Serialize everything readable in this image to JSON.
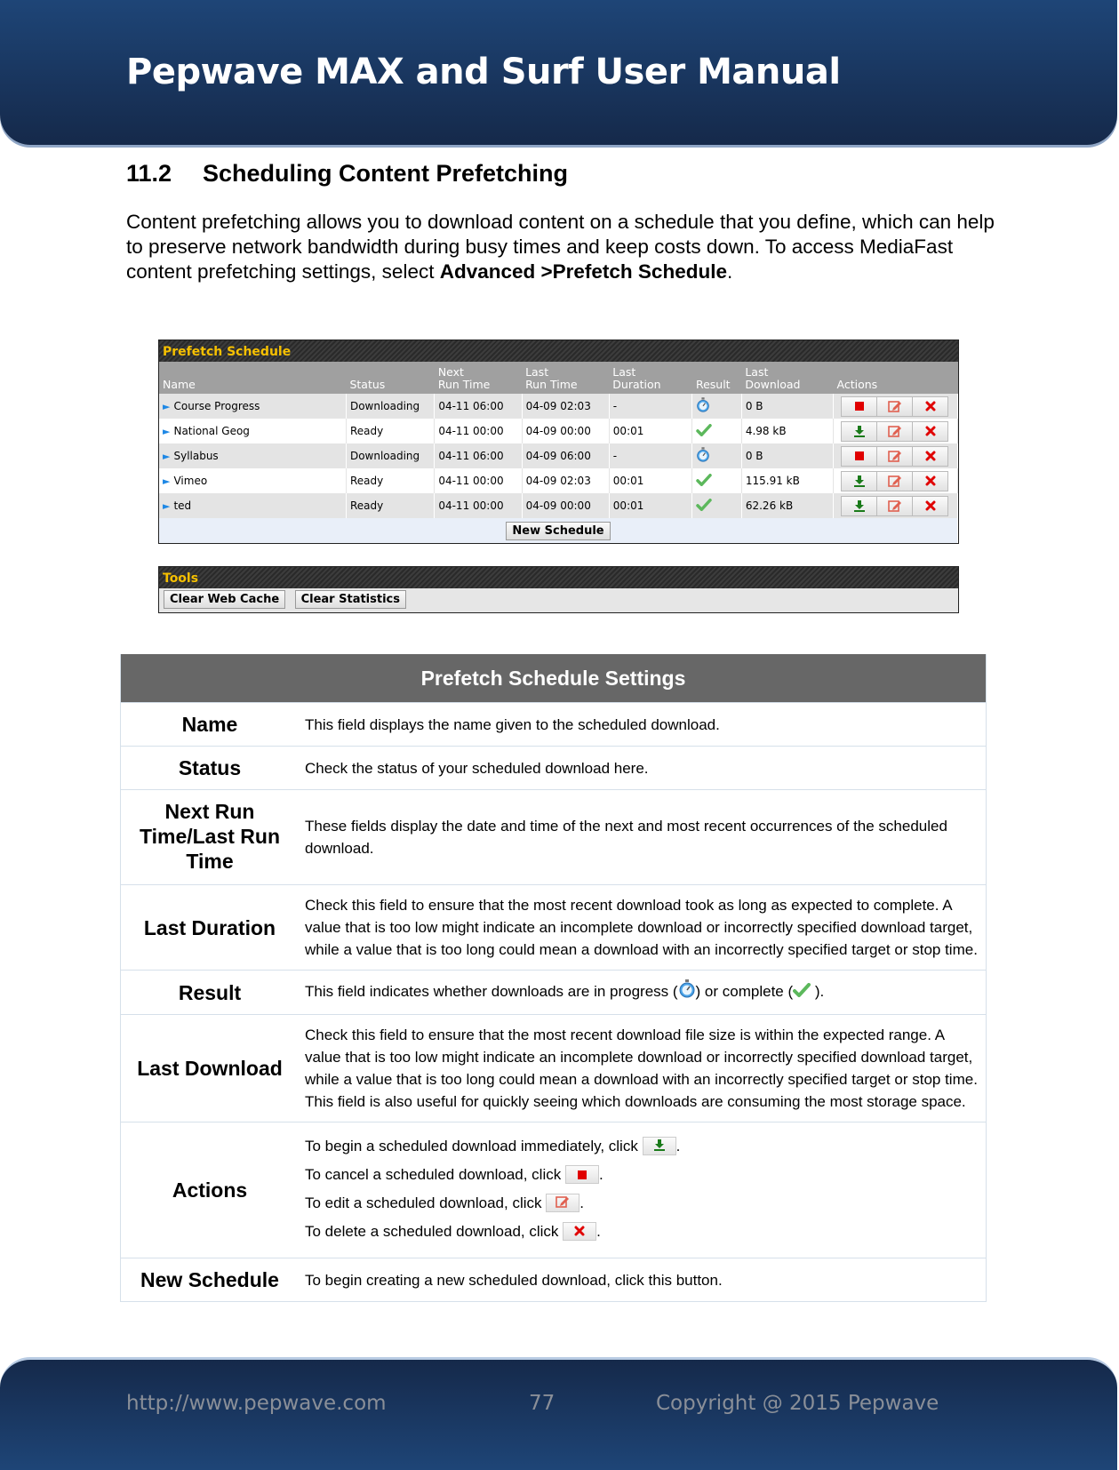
{
  "header": {
    "title": "Pepwave MAX and Surf User Manual"
  },
  "section": {
    "number": "11.2",
    "title": "Scheduling Content Prefetching",
    "intro_plain": "Content prefetching allows you to download content on a schedule that you define, which can help to preserve network bandwidth during busy times and keep costs down. To access MediaFast content prefetching settings, select ",
    "intro_bold": "Advanced >Prefetch Schedule",
    "intro_end": "."
  },
  "prefetch_panel": {
    "title": "Prefetch Schedule",
    "columns": [
      "Name",
      "Status",
      "Next Run Time",
      "Last Run Time",
      "Last Duration",
      "Result",
      "Last Download",
      "Actions"
    ],
    "column_lines": [
      [
        "",
        "Name"
      ],
      [
        "",
        "Status"
      ],
      [
        "Next",
        "Run Time"
      ],
      [
        "Last",
        "Run Time"
      ],
      [
        "Last",
        "Duration"
      ],
      [
        "",
        "Result"
      ],
      [
        "Last",
        "Download"
      ],
      [
        "",
        "Actions"
      ]
    ],
    "rows": [
      {
        "name": "Course Progress",
        "status": "Downloading",
        "next_run": "04-11 06:00",
        "last_run": "04-09 02:03",
        "duration": "-",
        "result": "in-progress",
        "last_download": "0 B",
        "primary_action": "stop"
      },
      {
        "name": "National Geog",
        "status": "Ready",
        "next_run": "04-11 00:00",
        "last_run": "04-09 00:00",
        "duration": "00:01",
        "result": "complete",
        "last_download": "4.98 kB",
        "primary_action": "download"
      },
      {
        "name": "Syllabus",
        "status": "Downloading",
        "next_run": "04-11 06:00",
        "last_run": "04-09 06:00",
        "duration": "-",
        "result": "in-progress",
        "last_download": "0 B",
        "primary_action": "stop"
      },
      {
        "name": "Vimeo",
        "status": "Ready",
        "next_run": "04-11 00:00",
        "last_run": "04-09 02:03",
        "duration": "00:01",
        "result": "complete",
        "last_download": "115.91 kB",
        "primary_action": "download"
      },
      {
        "name": "ted",
        "status": "Ready",
        "next_run": "04-11 00:00",
        "last_run": "04-09 00:00",
        "duration": "00:01",
        "result": "complete",
        "last_download": "62.26 kB",
        "primary_action": "download"
      }
    ],
    "new_schedule_label": "New Schedule"
  },
  "tools_panel": {
    "title": "Tools",
    "clear_web_cache_label": "Clear Web Cache",
    "clear_statistics_label": "Clear Statistics"
  },
  "settings_table": {
    "title": "Prefetch Schedule Settings",
    "rows": [
      {
        "key": "Name",
        "value": "This field displays the name given to the scheduled download."
      },
      {
        "key": "Status",
        "value": "Check the status of your scheduled download here."
      },
      {
        "key": "Next Run Time/Last Run Time",
        "value": "These fields display the date and time of the next and most recent occurrences of the scheduled download."
      },
      {
        "key": "Last Duration",
        "value": "Check this field to ensure that the most recent download took as long as expected to complete. A value that is too low might indicate an incomplete download or incorrectly specified download target, while a value that is too long could mean a download with an incorrectly specified target or stop time."
      },
      {
        "key": "Result",
        "value_before": "This field indicates whether downloads are in progress (",
        "value_mid": ") or complete (",
        "value_after": " )."
      },
      {
        "key": "Last Download",
        "value": "Check this field to ensure that the most recent download file size is within the expected range. A value that is too low might indicate an incomplete download or incorrectly specified download target, while a value that is too long could mean a download with an incorrectly specified target or stop time. This field is also useful for quickly seeing which downloads are consuming the most storage space."
      },
      {
        "key": "Actions",
        "lines": [
          "To begin a scheduled download immediately, click ",
          "To cancel a scheduled download, click ",
          "To edit a scheduled download, click ",
          "To delete a scheduled download, click "
        ]
      },
      {
        "key": "New Schedule",
        "value": "To begin creating a new scheduled download, click this button."
      }
    ]
  },
  "footer": {
    "url": "http://www.pepwave.com",
    "page": "77",
    "copyright": "Copyright @ 2015 Pepwave"
  },
  "colors": {
    "header_blue": "#1e4577",
    "panel_title_yellow": "#f6c000",
    "download_green": "#1a7a1a",
    "stop_red": "#e00000",
    "edit_salmon": "#e06050",
    "check_green": "#5cb85c",
    "settings_header_gray": "#676767"
  }
}
